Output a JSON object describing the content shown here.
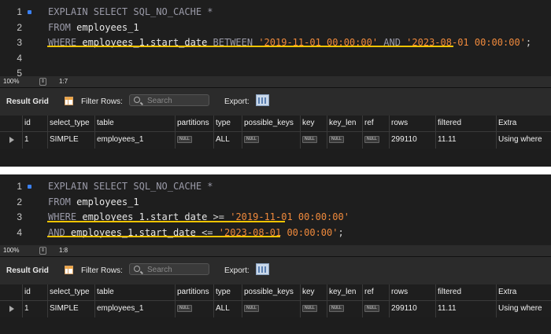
{
  "panels": [
    {
      "lines": [
        {
          "num": "1",
          "tokens": [
            {
              "t": "EXPLAIN SELECT SQL_NO_CACHE *",
              "c": "kw"
            }
          ]
        },
        {
          "num": "2",
          "tokens": [
            {
              "t": "FROM ",
              "c": "kw"
            },
            {
              "t": "employees_1",
              "c": "id"
            }
          ]
        },
        {
          "num": "3",
          "tokens": [
            {
              "t": "WHERE ",
              "c": "kw"
            },
            {
              "t": "employees_1.start_date ",
              "c": "id"
            },
            {
              "t": "BETWEEN ",
              "c": "kw"
            },
            {
              "t": "'2019-11-01 00:00:00'",
              "c": "str"
            },
            {
              "t": " AND ",
              "c": "kw"
            },
            {
              "t": "'2023-08-01 00:00:00'",
              "c": "str"
            },
            {
              "t": ";",
              "c": "op"
            }
          ]
        },
        {
          "num": "4",
          "tokens": []
        },
        {
          "num": "5",
          "tokens": []
        }
      ],
      "status": {
        "zoom": "100%",
        "cursor": "1:7"
      },
      "toolbar": {
        "result_grid": "Result Grid",
        "filter_rows": "Filter Rows:",
        "search_placeholder": "Search",
        "export": "Export:"
      },
      "columns": [
        "id",
        "select_type",
        "table",
        "partitions",
        "type",
        "possible_keys",
        "key",
        "key_len",
        "ref",
        "rows",
        "filtered",
        "Extra"
      ],
      "rows": [
        [
          "1",
          "SIMPLE",
          "employees_1",
          "NULL",
          "ALL",
          "NULL",
          "NULL",
          "NULL",
          "NULL",
          "299110",
          "11.11",
          "Using where"
        ]
      ]
    },
    {
      "lines": [
        {
          "num": "1",
          "tokens": [
            {
              "t": "EXPLAIN SELECT SQL_NO_CACHE *",
              "c": "kw"
            }
          ]
        },
        {
          "num": "2",
          "tokens": [
            {
              "t": "FROM ",
              "c": "kw"
            },
            {
              "t": "employees_1",
              "c": "id"
            }
          ]
        },
        {
          "num": "3",
          "tokens": [
            {
              "t": "WHERE ",
              "c": "kw"
            },
            {
              "t": "employees_1.start_date ",
              "c": "id"
            },
            {
              "t": ">= ",
              "c": "op"
            },
            {
              "t": "'2019-11-01 00:00:00'",
              "c": "str"
            }
          ]
        },
        {
          "num": "4",
          "tokens": [
            {
              "t": "AND ",
              "c": "kw"
            },
            {
              "t": "employees_1.start_date ",
              "c": "id"
            },
            {
              "t": "<= ",
              "c": "op"
            },
            {
              "t": "'2023-08-01 00:00:00'",
              "c": "str"
            },
            {
              "t": ";",
              "c": "op"
            }
          ]
        }
      ],
      "status": {
        "zoom": "100%",
        "cursor": "1:8"
      },
      "toolbar": {
        "result_grid": "Result Grid",
        "filter_rows": "Filter Rows:",
        "search_placeholder": "Search",
        "export": "Export:"
      },
      "columns": [
        "id",
        "select_type",
        "table",
        "partitions",
        "type",
        "possible_keys",
        "key",
        "key_len",
        "ref",
        "rows",
        "filtered",
        "Extra"
      ],
      "rows": [
        [
          "1",
          "SIMPLE",
          "employees_1",
          "NULL",
          "ALL",
          "NULL",
          "NULL",
          "NULL",
          "NULL",
          "299110",
          "11.11",
          "Using where"
        ]
      ]
    }
  ],
  "colors": {
    "highlight_underline": "#f5c400",
    "string": "#f08a3c",
    "keyword": "#9a9aa8",
    "breakpoint": "#3b82f6"
  }
}
